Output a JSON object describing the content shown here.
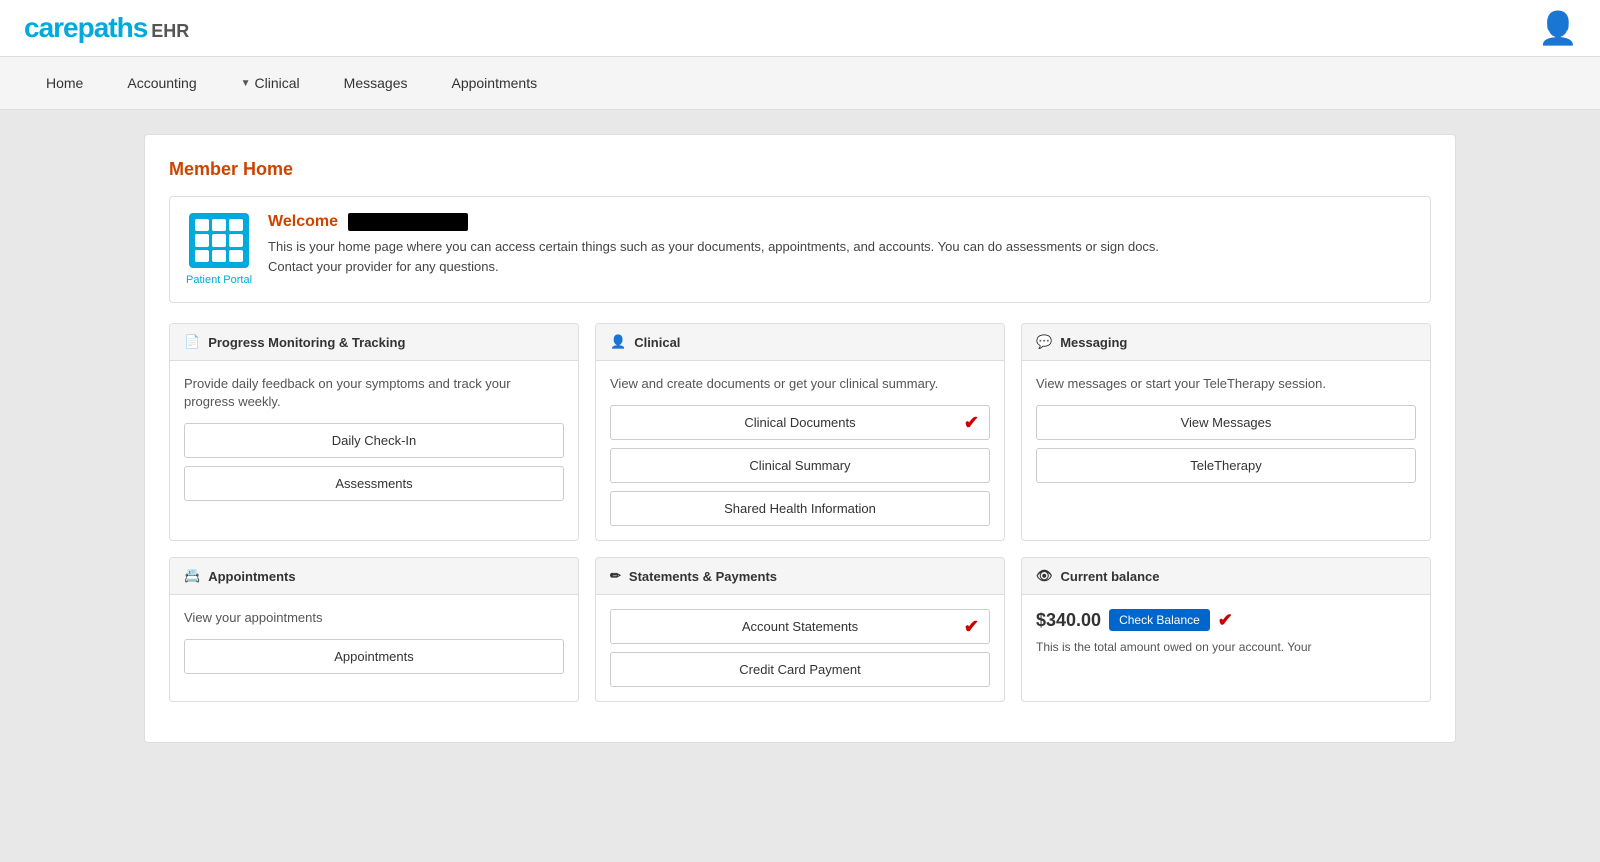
{
  "logo": {
    "carepaths": "carepaths",
    "ehr": "EHR"
  },
  "nav": {
    "items": [
      {
        "label": "Home",
        "id": "home",
        "dropdown": false
      },
      {
        "label": "Accounting",
        "id": "accounting",
        "dropdown": false
      },
      {
        "label": "Clinical",
        "id": "clinical",
        "dropdown": true
      },
      {
        "label": "Messages",
        "id": "messages",
        "dropdown": false
      },
      {
        "label": "Appointments",
        "id": "appointments",
        "dropdown": false
      }
    ]
  },
  "page": {
    "section_title": "Member Home"
  },
  "welcome": {
    "heading": "Welcome",
    "portal_label": "Patient Portal",
    "description_line1": "This is your home page where you can access certain things such as your documents, appointments, and accounts. You can do assessments or sign docs.",
    "description_line2": "Contact your provider for any questions."
  },
  "cards": [
    {
      "id": "progress",
      "header_icon": "document-icon",
      "header_label": "Progress Monitoring & Tracking",
      "description": "Provide daily feedback on your symptoms and track your progress weekly.",
      "buttons": [
        {
          "label": "Daily Check-In",
          "id": "daily-checkin",
          "has_check": false
        },
        {
          "label": "Assessments",
          "id": "assessments",
          "has_check": false
        }
      ]
    },
    {
      "id": "clinical",
      "header_icon": "person-icon",
      "header_label": "Clinical",
      "description": "View and create documents or get your clinical summary.",
      "buttons": [
        {
          "label": "Clinical Documents",
          "id": "clinical-documents",
          "has_check": true
        },
        {
          "label": "Clinical Summary",
          "id": "clinical-summary",
          "has_check": false
        },
        {
          "label": "Shared Health Information",
          "id": "shared-health",
          "has_check": false
        }
      ]
    },
    {
      "id": "messaging",
      "header_icon": "chat-icon",
      "header_label": "Messaging",
      "description": "View messages or start your TeleTherapy session.",
      "buttons": [
        {
          "label": "View Messages",
          "id": "view-messages",
          "has_check": false
        },
        {
          "label": "TeleTherapy",
          "id": "teletherapy",
          "has_check": false
        }
      ]
    },
    {
      "id": "appointments",
      "header_icon": "person-card-icon",
      "header_label": "Appointments",
      "description": "View your appointments",
      "buttons": [
        {
          "label": "Appointments",
          "id": "appointments-btn",
          "has_check": false
        }
      ]
    },
    {
      "id": "statements",
      "header_icon": "edit-icon",
      "header_label": "Statements & Payments",
      "description": "",
      "buttons": [
        {
          "label": "Account Statements",
          "id": "account-statements",
          "has_check": true
        },
        {
          "label": "Credit Card Payment",
          "id": "credit-card-payment",
          "has_check": false
        }
      ]
    },
    {
      "id": "balance",
      "header_icon": "eye-icon",
      "header_label": "Current balance",
      "description": "",
      "amount": "$340.00",
      "check_balance_label": "Check Balance",
      "balance_text": "This is the total amount owed on your account. Your"
    }
  ]
}
